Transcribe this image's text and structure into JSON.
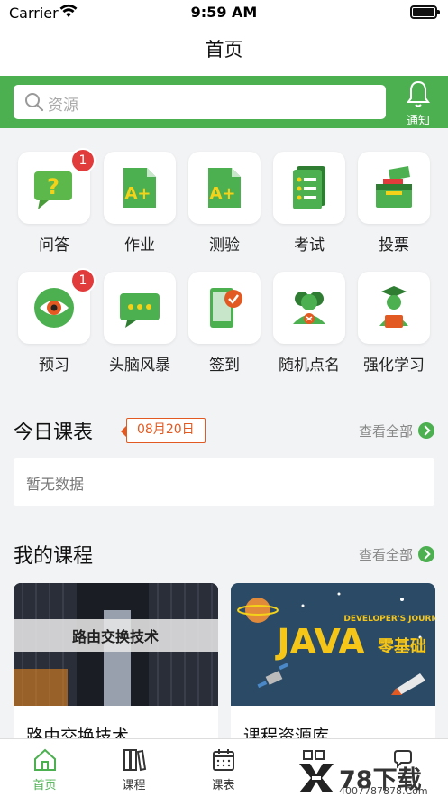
{
  "status_bar": {
    "carrier": "Carrier",
    "time": "9:59 AM"
  },
  "nav": {
    "title": "首页"
  },
  "search": {
    "placeholder": "资源",
    "notify_label": "通知"
  },
  "colors": {
    "brand_green": "#4cb050",
    "badge_red": "#e23b3b",
    "date_orange": "#e25a22"
  },
  "features": [
    {
      "label": "问答",
      "icon": "question-bubble-icon",
      "badge": "1"
    },
    {
      "label": "作业",
      "icon": "homework-doc-icon"
    },
    {
      "label": "测验",
      "icon": "quiz-doc-icon"
    },
    {
      "label": "考试",
      "icon": "exam-checklist-icon"
    },
    {
      "label": "投票",
      "icon": "ballot-box-icon"
    },
    {
      "label": "预习",
      "icon": "eye-icon",
      "badge": "1"
    },
    {
      "label": "头脑风暴",
      "icon": "brainstorm-chat-icon"
    },
    {
      "label": "签到",
      "icon": "phone-checkin-icon"
    },
    {
      "label": "随机点名",
      "icon": "random-roll-call-icon"
    },
    {
      "label": "强化学习",
      "icon": "graduate-icon"
    }
  ],
  "schedule": {
    "title": "今日课表",
    "date": "08月20日",
    "view_all": "查看全部",
    "empty_text": "暂无数据"
  },
  "courses": {
    "title": "我的课程",
    "view_all": "查看全部",
    "items": [
      {
        "title": "路由交换技术",
        "banner_text": "路由交换技术"
      },
      {
        "title": "课程资源库",
        "banner_text": "JAVA",
        "banner_sub": "零基础",
        "banner_small": "DEVELOPER'S JOURNAL"
      }
    ]
  },
  "tabbar": {
    "items": [
      {
        "label": "首页",
        "icon": "home-icon",
        "active": true
      },
      {
        "label": "课程",
        "icon": "books-icon"
      },
      {
        "label": "课表",
        "icon": "calendar-icon"
      },
      {
        "label": "",
        "icon": "grid-icon"
      },
      {
        "label": "",
        "icon": "profile-icon"
      }
    ]
  },
  "watermark": {
    "text": "78下载",
    "url": "4007787878.Com"
  }
}
